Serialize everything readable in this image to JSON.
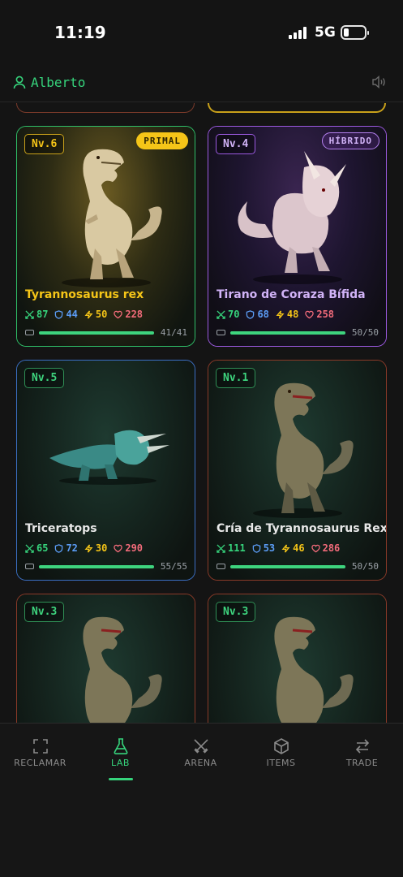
{
  "status_bar": {
    "time": "11:19",
    "network": "5G"
  },
  "header": {
    "username": "Alberto"
  },
  "cards": [
    {
      "level": "Nv.6",
      "tag": "PRIMAL",
      "name": "Tyrannosaurus rex",
      "attack": "87",
      "defense": "44",
      "speed": "50",
      "health": "228",
      "energy_text": "41/41",
      "energy_fraction": 1.0
    },
    {
      "level": "Nv.4",
      "tag": "HÍBRIDO",
      "name": "Tirano de Coraza Bífida",
      "attack": "70",
      "defense": "68",
      "speed": "48",
      "health": "258",
      "energy_text": "50/50",
      "energy_fraction": 1.0
    },
    {
      "level": "Nv.5",
      "tag": "",
      "name": "Triceratops",
      "attack": "65",
      "defense": "72",
      "speed": "30",
      "health": "290",
      "energy_text": "55/55",
      "energy_fraction": 1.0
    },
    {
      "level": "Nv.1",
      "tag": "",
      "name": "Cría de Tyrannosaurus Rex",
      "attack": "111",
      "defense": "53",
      "speed": "46",
      "health": "286",
      "energy_text": "50/50",
      "energy_fraction": 1.0
    },
    {
      "level": "Nv.3",
      "tag": "",
      "name": "",
      "attack": "",
      "defense": "",
      "speed": "",
      "health": "",
      "energy_text": "",
      "energy_fraction": 1.0
    },
    {
      "level": "Nv.3",
      "tag": "",
      "name": "",
      "attack": "",
      "defense": "",
      "speed": "",
      "health": "",
      "energy_text": "",
      "energy_fraction": 1.0
    }
  ],
  "nav": [
    {
      "label": "RECLAMAR",
      "icon": "scan-icon"
    },
    {
      "label": "LAB",
      "icon": "flask-icon"
    },
    {
      "label": "ARENA",
      "icon": "swords-icon"
    },
    {
      "label": "ITEMS",
      "icon": "box-icon"
    },
    {
      "label": "TRADE",
      "icon": "swap-icon"
    }
  ],
  "colors": {
    "accent": "#36d47c",
    "primal": "#f5c518",
    "hybrid": "#b580f0",
    "attack": "#36d47c",
    "defense": "#5b9cf5",
    "speed": "#f5c518",
    "health": "#f26b7a"
  }
}
